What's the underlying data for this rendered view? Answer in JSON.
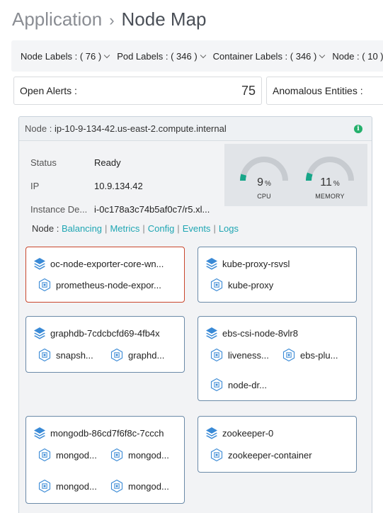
{
  "breadcrumb": {
    "app": "Application",
    "separator": "›",
    "page": "Node Map"
  },
  "filters": [
    {
      "label": "Node Labels : ( 76 )"
    },
    {
      "label": "Pod Labels : ( 346 )"
    },
    {
      "label": "Container Labels : ( 346 )"
    },
    {
      "label": "Node : ( 10 )"
    }
  ],
  "stats": {
    "open_alerts": {
      "label": "Open Alerts :",
      "value": "75"
    },
    "anomalous": {
      "label": "Anomalous Entities :"
    }
  },
  "node": {
    "header_label": "Node :",
    "name": "ip-10-9-134-42.us-east-2.compute.internal",
    "properties": [
      {
        "key": "Status",
        "value": "Ready"
      },
      {
        "key": "IP",
        "value": "10.9.134.42"
      },
      {
        "key": "Instance De...",
        "value": "i-0c178a3c74b5af0c7/r5.xl..."
      }
    ],
    "gauges": [
      {
        "value": 9,
        "unit": "%",
        "label": "CPU",
        "fill": 0.09
      },
      {
        "value": 11,
        "unit": "%",
        "label": "MEMORY",
        "fill": 0.11
      }
    ],
    "links_label": "Node :",
    "links": [
      "Balancing",
      "Metrics",
      "Config",
      "Events",
      "Logs"
    ],
    "link_separator": "|"
  },
  "pods": [
    {
      "name": "oc-node-exporter-core-wn...",
      "alert": true,
      "containers": [
        "prometheus-node-expor..."
      ]
    },
    {
      "name": "kube-proxy-rsvsl",
      "alert": false,
      "containers": [
        "kube-proxy"
      ]
    },
    {
      "name": "graphdb-7cdcbcfd69-4fb4x",
      "alert": false,
      "containers": [
        "snapsh...",
        "graphd..."
      ]
    },
    {
      "name": "ebs-csi-node-8vlr8",
      "alert": false,
      "containers": [
        "liveness...",
        "ebs-plu...",
        "node-dr..."
      ]
    },
    {
      "name": "mongodb-86cd7f6f8c-7ccch",
      "alert": false,
      "containers": [
        "mongod...",
        "mongod...",
        "mongod...",
        "mongod..."
      ]
    },
    {
      "name": "zookeeper-0",
      "alert": false,
      "containers": [
        "zookeeper-container"
      ]
    }
  ],
  "colors": {
    "accent_link": "#1fa6b3",
    "gauge_fill": "#17a689",
    "gauge_track": "#c7cbd0",
    "alert_border": "#c9462c",
    "pod_icon": "#3a8ad6"
  }
}
